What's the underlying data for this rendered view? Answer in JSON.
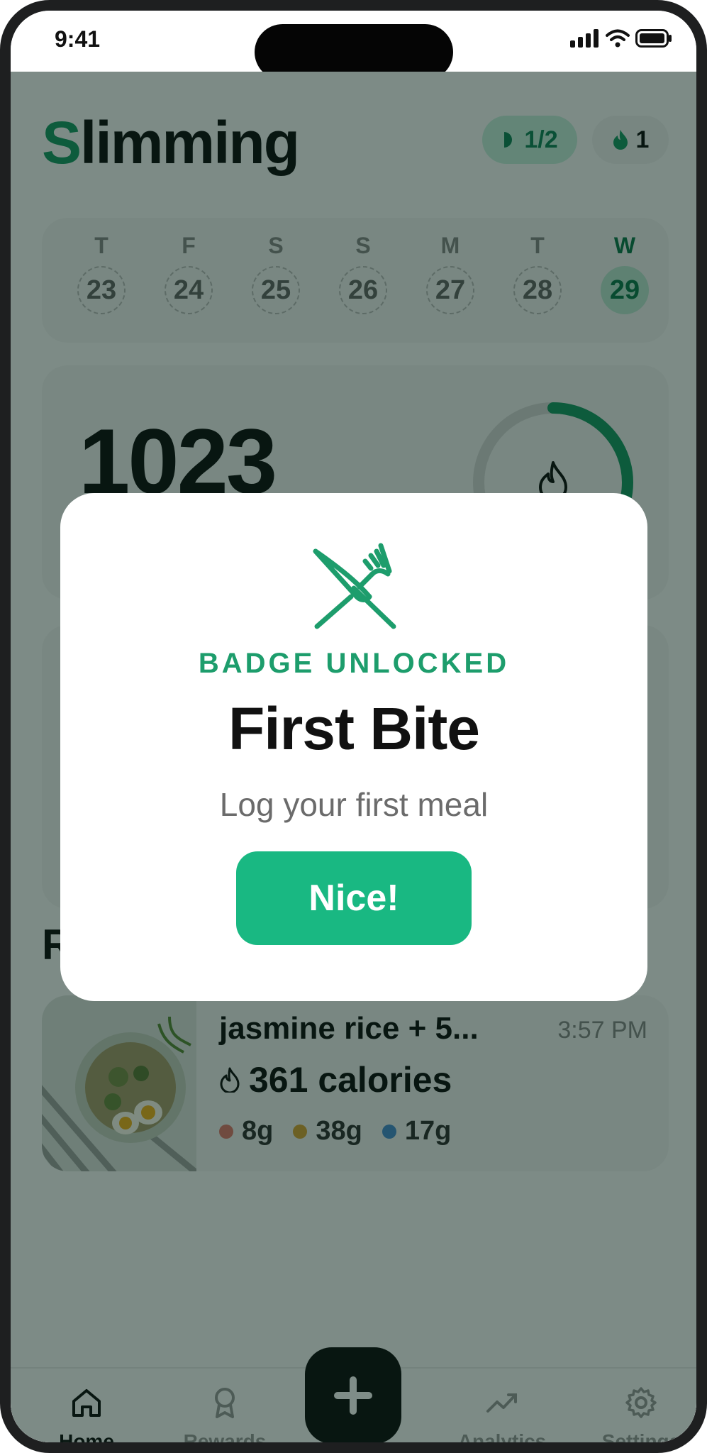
{
  "status_bar": {
    "time": "9:41"
  },
  "header": {
    "title_initial": "S",
    "title_rest": "limming",
    "progress": "1/2",
    "streak": "1"
  },
  "week": [
    {
      "letter": "T",
      "date": "23",
      "active": false
    },
    {
      "letter": "F",
      "date": "24",
      "active": false
    },
    {
      "letter": "S",
      "date": "25",
      "active": false
    },
    {
      "letter": "S",
      "date": "26",
      "active": false
    },
    {
      "letter": "M",
      "date": "27",
      "active": false
    },
    {
      "letter": "T",
      "date": "28",
      "active": false
    },
    {
      "letter": "W",
      "date": "29",
      "active": true
    }
  ],
  "calories": {
    "value": "1023",
    "ring_progress": 0.38
  },
  "recent": {
    "title_visible": "R"
  },
  "meal": {
    "name": "jasmine rice + 5...",
    "time": "3:57 PM",
    "calories": "361 calories",
    "protein": "8g",
    "carbs": "38g",
    "fat": "17g"
  },
  "bottom_nav": {
    "home": "Home",
    "rewards": "Rewards",
    "analytics": "Analytics",
    "settings": "Settings"
  },
  "modal": {
    "label": "BADGE UNLOCKED",
    "name": "First Bite",
    "description": "Log your first meal",
    "button": "Nice!"
  },
  "colors": {
    "accent": "#1a9a67",
    "button": "#19b882",
    "protein": "#e07a6f",
    "carbs": "#d9a437",
    "fat": "#4a8fd0"
  },
  "icons": [
    "signal-icon",
    "wifi-icon",
    "battery-icon",
    "half-circle-icon",
    "flame-icon",
    "knife-fork-icon",
    "home-icon",
    "ribbon-icon",
    "plus-icon",
    "trend-icon",
    "gear-icon"
  ]
}
